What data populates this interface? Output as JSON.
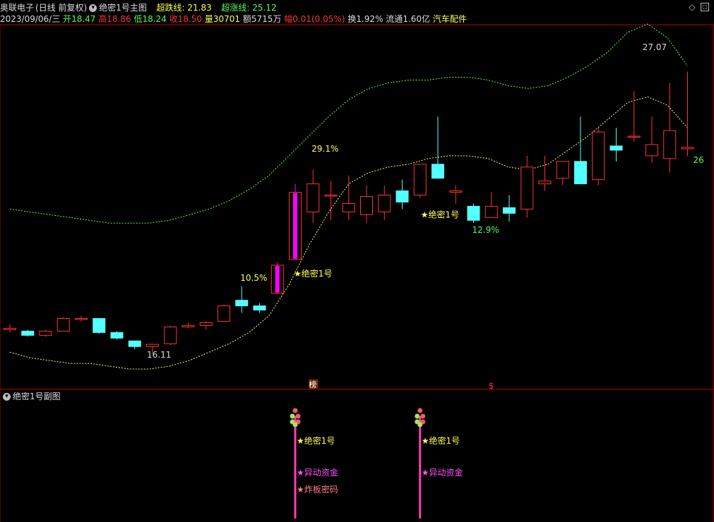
{
  "header": {
    "stock_name": "奥联电子",
    "period": "(日线 前复权)",
    "indicator_icon": "chevron-circle-icon",
    "indicator_name": "绝密1号主图",
    "oversold_label": "超跌线:",
    "oversold_value": "21.83",
    "overbought_label": "超涨线:",
    "overbought_value": "25.12",
    "date": "2023/09/06/三",
    "open_label": "开",
    "open_value": "18.47",
    "high_label": "高",
    "high_value": "18.86",
    "low_label": "低",
    "low_value": "18.24",
    "close_label": "收",
    "close_value": "18.50",
    "volume_label": "量",
    "volume_value": "30701",
    "amount_label": "额",
    "amount_value": "5715万",
    "change_label": "幅",
    "change_value": "0.01(0.05%)",
    "turnover_label": "换",
    "turnover_value": "1.92%",
    "float_label": "流通",
    "float_value": "1.60亿",
    "sector": "汽车配件",
    "settings_icon": "settings-circle-icon",
    "diamond_icon": "diamond-icon",
    "restore_icon": "restore-window-icon"
  },
  "colors": {
    "up": "#ff3232",
    "down": "#54ffff",
    "dark_down": "#00a8a8",
    "highlight": "#ff00ff",
    "yellow": "#ffff54",
    "green": "#54ff54",
    "grid": "#b00000"
  },
  "chart_data": {
    "type": "candlestick",
    "annotations": {
      "high_label": "27.07",
      "low_label": "16.11",
      "last_label": "26",
      "pct_1": "10.5%",
      "pct_2": "29.1%",
      "pct_3": "12.9%",
      "signal_label": "★绝密1号",
      "badge_1": "榜",
      "badge_2": "$"
    },
    "upper_band": [
      21.3,
      21.2,
      21.1,
      21.0,
      20.9,
      20.8,
      20.8,
      20.8,
      20.9,
      21.1,
      21.3,
      21.6,
      22.0,
      22.5,
      23.2,
      23.9,
      24.6,
      25.2,
      25.6,
      25.8,
      25.9,
      25.9,
      26.0,
      26.0,
      25.9,
      25.7,
      25.6,
      25.7,
      26.0,
      26.4,
      26.9,
      27.6,
      27.9,
      27.4,
      26.4
    ],
    "lower_band": [
      16.2,
      16.0,
      15.9,
      15.8,
      15.8,
      15.7,
      15.6,
      15.6,
      15.7,
      15.9,
      16.2,
      16.5,
      16.9,
      17.5,
      18.6,
      20.0,
      21.2,
      22.2,
      22.6,
      22.8,
      22.9,
      23.1,
      23.2,
      23.2,
      23.1,
      22.8,
      22.7,
      22.9,
      23.4,
      23.9,
      24.5,
      25.1,
      25.3,
      25.0,
      24.2
    ],
    "candles": [
      {
        "o": 17.0,
        "h": 17.2,
        "l": 16.9,
        "c": 17.05
      },
      {
        "o": 16.95,
        "h": 17.0,
        "l": 16.75,
        "c": 16.8
      },
      {
        "o": 16.8,
        "h": 17.0,
        "l": 16.75,
        "c": 16.95
      },
      {
        "o": 16.95,
        "h": 17.45,
        "l": 16.95,
        "c": 17.4
      },
      {
        "o": 17.4,
        "h": 17.5,
        "l": 17.3,
        "c": 17.4
      },
      {
        "o": 17.4,
        "h": 17.4,
        "l": 16.85,
        "c": 16.9
      },
      {
        "o": 16.9,
        "h": 16.95,
        "l": 16.65,
        "c": 16.7
      },
      {
        "o": 16.6,
        "h": 16.6,
        "l": 16.3,
        "c": 16.4
      },
      {
        "o": 16.4,
        "h": 16.5,
        "l": 16.15,
        "c": 16.48
      },
      {
        "o": 16.5,
        "h": 17.15,
        "l": 16.45,
        "c": 17.1
      },
      {
        "o": 17.1,
        "h": 17.25,
        "l": 17.05,
        "c": 17.15
      },
      {
        "o": 17.15,
        "h": 17.3,
        "l": 17.0,
        "c": 17.25
      },
      {
        "o": 17.3,
        "h": 17.9,
        "l": 17.3,
        "c": 17.85
      },
      {
        "o": 18.05,
        "h": 18.55,
        "l": 17.6,
        "c": 17.85
      },
      {
        "o": 17.85,
        "h": 17.95,
        "l": 17.6,
        "c": 17.7
      },
      {
        "o": 18.3,
        "h": 19.4,
        "l": 18.3,
        "c": 19.3,
        "hl": true
      },
      {
        "o": 19.5,
        "h": 22.2,
        "l": 19.5,
        "c": 21.9,
        "hl": true
      },
      {
        "o": 21.2,
        "h": 22.7,
        "l": 20.8,
        "c": 22.2
      },
      {
        "o": 21.8,
        "h": 22.3,
        "l": 20.9,
        "c": 21.8
      },
      {
        "o": 21.2,
        "h": 22.5,
        "l": 20.9,
        "c": 21.5
      },
      {
        "o": 21.1,
        "h": 22.15,
        "l": 20.8,
        "c": 21.75
      },
      {
        "o": 21.2,
        "h": 22.15,
        "l": 20.9,
        "c": 21.8
      },
      {
        "o": 21.95,
        "h": 22.35,
        "l": 21.3,
        "c": 21.55
      },
      {
        "o": 21.8,
        "h": 22.9,
        "l": 21.7,
        "c": 22.9
      },
      {
        "o": 22.9,
        "h": 24.6,
        "l": 22.4,
        "c": 22.4
      },
      {
        "o": 21.9,
        "h": 22.15,
        "l": 21.5,
        "c": 21.95
      },
      {
        "o": 21.4,
        "h": 21.5,
        "l": 20.8,
        "c": 20.9
      },
      {
        "o": 21.0,
        "h": 21.9,
        "l": 21.1,
        "c": 21.4
      },
      {
        "o": 21.35,
        "h": 21.8,
        "l": 20.85,
        "c": 21.15
      },
      {
        "o": 21.3,
        "h": 23.2,
        "l": 21.0,
        "c": 22.8
      },
      {
        "o": 22.2,
        "h": 23.2,
        "l": 21.95,
        "c": 22.3
      },
      {
        "o": 22.4,
        "h": 23.0,
        "l": 22.15,
        "c": 23.0
      },
      {
        "o": 23.0,
        "h": 24.6,
        "l": 22.2,
        "c": 22.2
      },
      {
        "o": 22.35,
        "h": 24.2,
        "l": 22.15,
        "c": 24.05
      },
      {
        "o": 23.55,
        "h": 24.2,
        "l": 23.0,
        "c": 23.4
      },
      {
        "o": 23.9,
        "h": 25.5,
        "l": 23.7,
        "c": 23.9
      },
      {
        "o": 23.2,
        "h": 24.6,
        "l": 22.95,
        "c": 23.6
      },
      {
        "o": 23.1,
        "h": 25.8,
        "l": 22.6,
        "c": 24.1
      },
      {
        "o": 23.45,
        "h": 26.2,
        "l": 23.2,
        "c": 23.5
      }
    ]
  },
  "sub_chart": {
    "chevron_icon": "chevron-circle-icon",
    "title": "绝密1号副图",
    "signals": [
      {
        "labels": [
          "★绝密1号",
          "★异动资金",
          "★炸板密码"
        ]
      },
      {
        "labels": [
          "★绝密1号",
          "★异动资金"
        ]
      }
    ]
  }
}
